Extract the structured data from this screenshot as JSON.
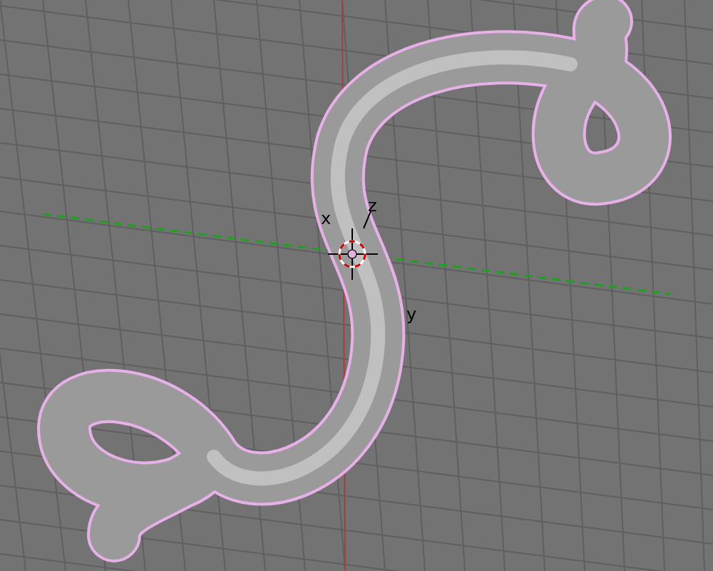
{
  "viewport": {
    "axis_labels": [
      {
        "text": "x"
      },
      {
        "text": "z"
      },
      {
        "text": "y"
      }
    ]
  }
}
